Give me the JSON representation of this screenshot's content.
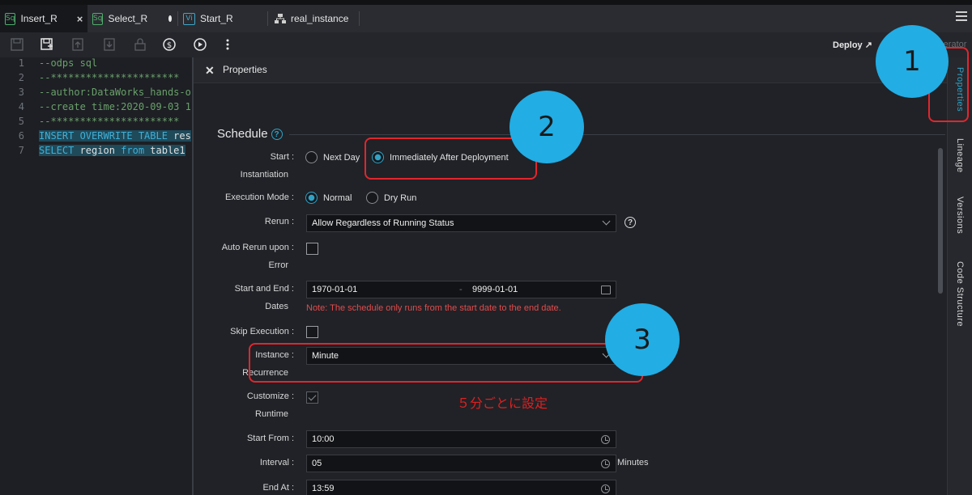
{
  "tabs": [
    {
      "badge": "Sq",
      "label": "Insert_R",
      "close": "×"
    },
    {
      "badge": "Sq",
      "label": "Select_R"
    },
    {
      "badge": "Vi",
      "label": "Start_R"
    },
    {
      "label": "real_instance"
    }
  ],
  "toolbar": {
    "deploy_label": "Deploy ↗",
    "operator_label": "Operator ↗"
  },
  "editor": {
    "lines": [
      {
        "num": "1",
        "text": "--odps sql"
      },
      {
        "num": "2",
        "text": "--**********************"
      },
      {
        "num": "3",
        "text": "--author:DataWorks_hands-o"
      },
      {
        "num": "4",
        "text": "--create time:2020-09-03 1"
      },
      {
        "num": "5",
        "text": "--**********************"
      },
      {
        "num": "6",
        "kw1": "INSERT OVERWRITE TABLE",
        "rest": " res"
      },
      {
        "num": "7",
        "kw1": "SELECT",
        "mid": " region ",
        "kw2": "from",
        "rest": " table1"
      }
    ]
  },
  "panel": {
    "close": "✕",
    "title": "Properties",
    "section_title": "Schedule",
    "start_instantiation": {
      "label_1": "Start :",
      "label_2": "Instantiation",
      "options": [
        "Next Day",
        "Immediately After Deployment"
      ],
      "selected": "Immediately After Deployment"
    },
    "execution_mode": {
      "label": "Execution Mode :",
      "options": [
        "Normal",
        "Dry Run"
      ],
      "selected": "Normal"
    },
    "rerun": {
      "label": "Rerun :",
      "value": "Allow Regardless of Running Status"
    },
    "auto_rerun": {
      "label_1": "Auto Rerun upon :",
      "label_2": "Error",
      "checked": false
    },
    "dates": {
      "label_1": "Start and End :",
      "label_2": "Dates",
      "start": "1970-01-01",
      "separator": "-",
      "end": "9999-01-01",
      "note": "Note: The schedule only runs from the start date to the end date."
    },
    "skip_execution": {
      "label": "Skip Execution :",
      "checked": false
    },
    "instance_recurrence": {
      "label_1": "Instance :",
      "label_2": "Recurrence",
      "value": "Minute"
    },
    "customize_runtime": {
      "label_1": "Customize :",
      "label_2": "Runtime",
      "checked": true
    },
    "start_from": {
      "label": "Start From :",
      "value": "10:00"
    },
    "interval": {
      "label": "Interval :",
      "value": "05",
      "unit": "Minutes"
    },
    "end_at": {
      "label": "End At :",
      "value": "13:59"
    }
  },
  "rail": {
    "items": [
      "Properties",
      "Lineage",
      "Versions",
      "Code Structure"
    ],
    "active": "Properties"
  },
  "annotations": {
    "callouts": [
      "1",
      "2",
      "3"
    ],
    "note": "５分ごとに設定",
    "highlight_color": "#e2262c",
    "callout_color": "#22ade4"
  }
}
